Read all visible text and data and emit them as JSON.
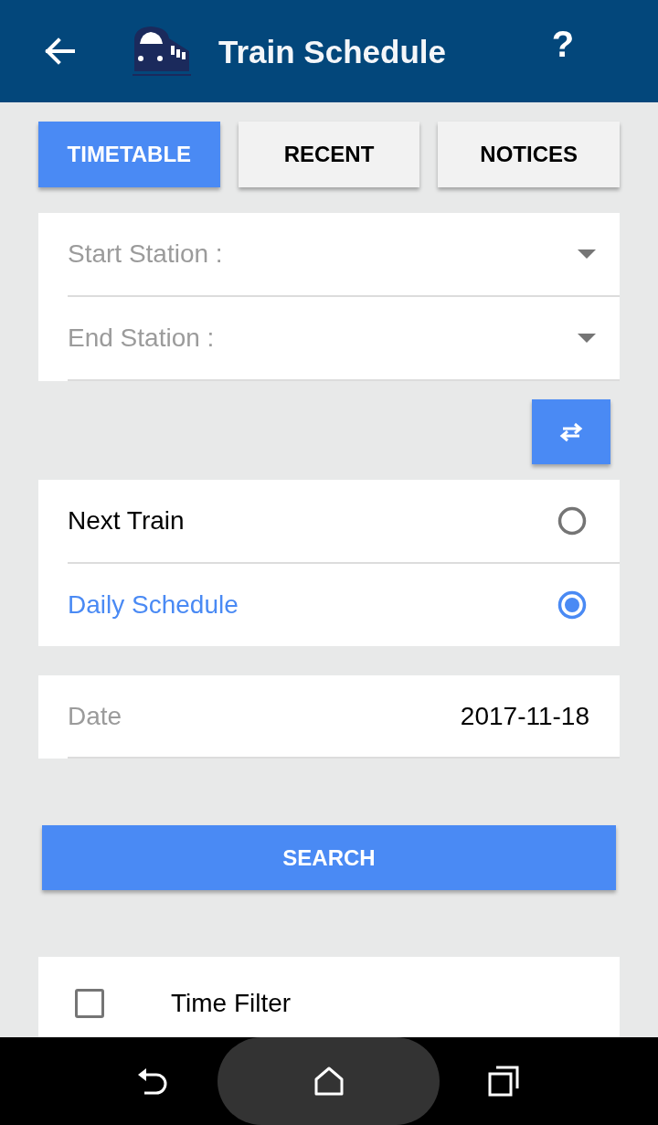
{
  "app_bar": {
    "title": "Train Schedule",
    "help_label": "?"
  },
  "tabs": [
    {
      "label": "TIMETABLE",
      "selected": true
    },
    {
      "label": "RECENT",
      "selected": false
    },
    {
      "label": "NOTICES",
      "selected": false
    }
  ],
  "stations": [
    {
      "label": "Start Station :"
    },
    {
      "label": "End Station :"
    }
  ],
  "modes": [
    {
      "label": "Next Train",
      "selected": false
    },
    {
      "label": "Daily Schedule",
      "selected": true
    }
  ],
  "date": {
    "label": "Date",
    "value": "2017-11-18"
  },
  "search_button": "SEARCH",
  "time_filter": {
    "label": "Time Filter",
    "checked": false
  }
}
